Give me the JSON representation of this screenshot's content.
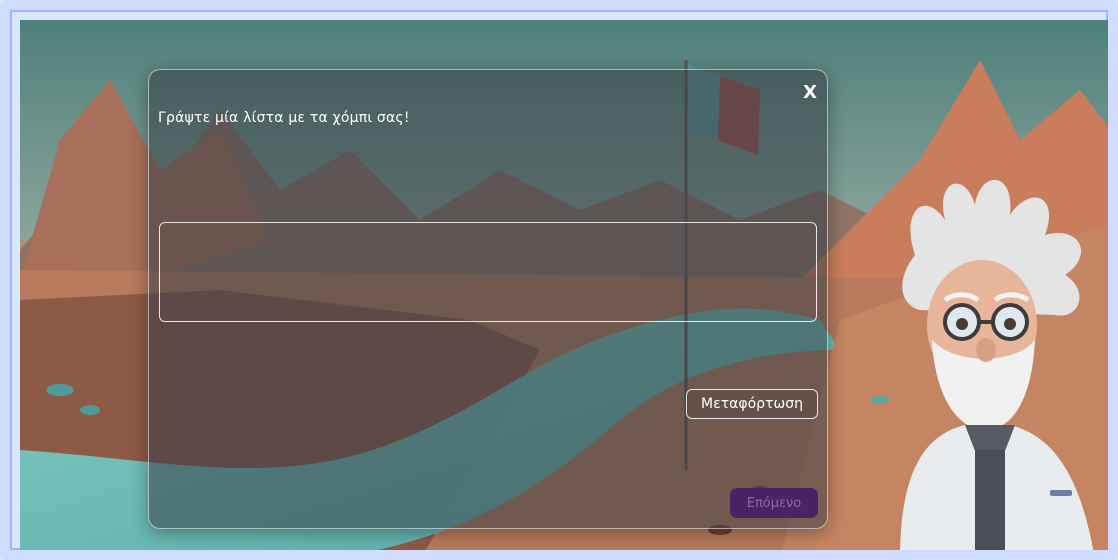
{
  "dialog": {
    "title": "Γράψτε μία λίστα με τα χόμπι σας!",
    "close_label": "X",
    "answer_value": "",
    "upload_label": "Μεταφόρτωση",
    "next_label": "Επόμενο"
  },
  "icons": {
    "close": "close-icon",
    "flag": "flag-icon",
    "character": "scientist-character"
  },
  "colors": {
    "next_button_bg": "#4a2366",
    "next_button_text": "#8a6aa8",
    "frame_border": "#cfdcff"
  }
}
